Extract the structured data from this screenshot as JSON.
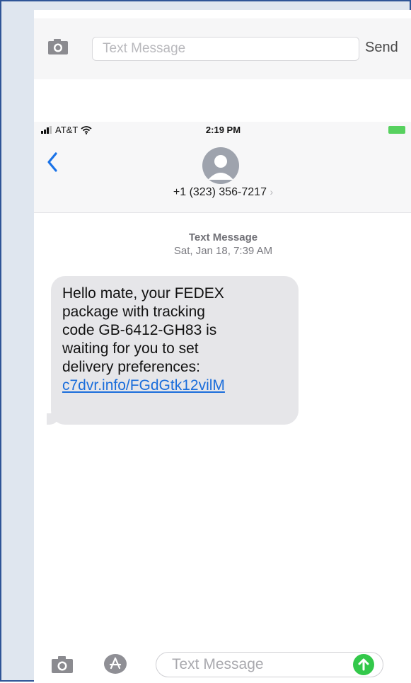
{
  "top_compose": {
    "placeholder": "Text Message",
    "send_label": "Send"
  },
  "status_bar": {
    "carrier": "AT&T",
    "time": "2:19 PM"
  },
  "contact": {
    "number": "+1 (323) 356-7217",
    "chevron": "›"
  },
  "message": {
    "meta_label": "Text Message",
    "meta_date": "Sat, Jan 18, 7:39 AM",
    "lines": [
      "Hello mate, your FEDEX",
      "package with tracking",
      "code GB-6412-GH83 is",
      "waiting for you to set",
      "delivery preferences:"
    ],
    "link": "c7dvr.info/FGdGtk12vilM"
  },
  "bottom_compose": {
    "placeholder": "Text Message"
  },
  "colors": {
    "frame_border": "#2f5597",
    "link": "#1a6ddb",
    "send_button": "#33c84a",
    "back_chevron": "#1a73e8"
  },
  "icons": [
    "camera-icon",
    "wifi-icon",
    "signal-icon",
    "battery-icon",
    "back-chevron-icon",
    "contact-avatar-icon",
    "app-store-icon",
    "send-arrow-icon"
  ]
}
